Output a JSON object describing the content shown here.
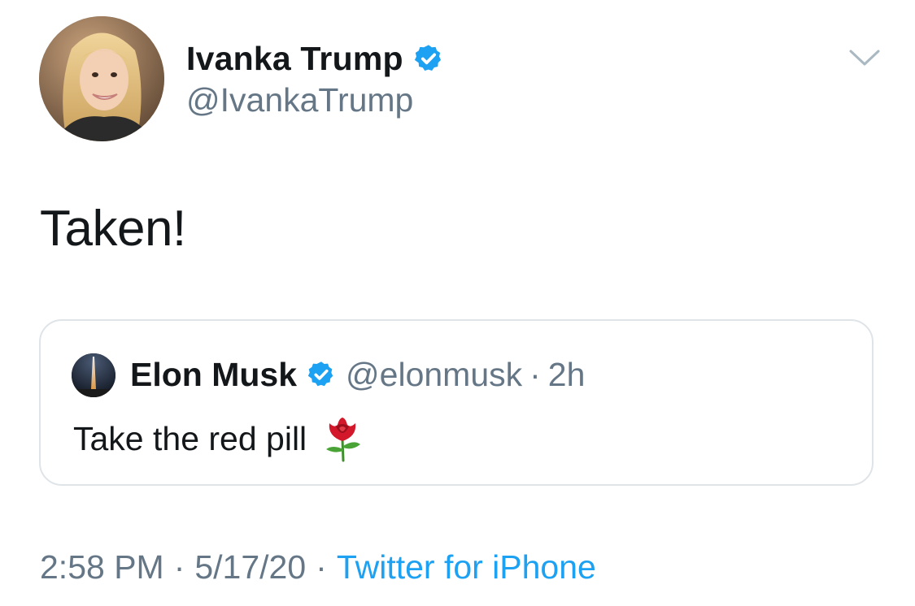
{
  "author": {
    "name": "Ivanka Trump",
    "handle": "@IvankaTrump",
    "verified": true,
    "avatar_icon": "profile-photo"
  },
  "tweet": {
    "text": "Taken!"
  },
  "quoted_tweet": {
    "name": "Elon Musk",
    "handle": "@elonmusk",
    "separator": "·",
    "time": "2h",
    "text": "Take the red pill",
    "emoji_icon": "rose-emoji-icon",
    "verified": true
  },
  "meta": {
    "time": "2:58 PM",
    "separator": "·",
    "date": "5/17/20",
    "separator2": "·",
    "source": "Twitter for iPhone"
  },
  "colors": {
    "text": "#14171a",
    "secondary": "#657786",
    "link": "#1da1f2",
    "verified": "#1da1f2",
    "border": "#dfe4e8"
  }
}
